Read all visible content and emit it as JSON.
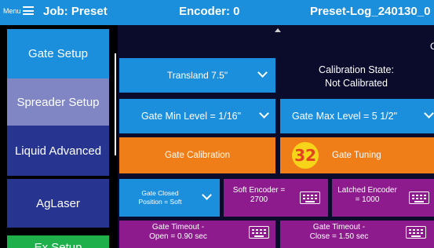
{
  "header": {
    "menu_label": "Menu",
    "job": "Job: Preset",
    "encoder": "Encoder: 0",
    "log": "Preset-Log_240130_0"
  },
  "sidebar": {
    "items": [
      {
        "label": "Gate Setup"
      },
      {
        "label": "Spreader Setup"
      },
      {
        "label": "Liquid Advanced"
      },
      {
        "label": "AgLaser"
      },
      {
        "label": "Ex Setup"
      }
    ]
  },
  "main": {
    "edge_char": "C",
    "transland": "Transland 7.5\"",
    "calibration_state_label": "Calibration State:",
    "calibration_state_value": "Not Calibrated",
    "gate_min": "Gate Min Level = 1/16\"",
    "gate_max": "Gate Max Level = 5 1/2\"",
    "gate_calibration": "Gate Calibration",
    "gate_tuning": "Gate Tuning",
    "badge": "32",
    "gate_closed_line1": "Gate Closed",
    "gate_closed_line2": "Position = Soft",
    "soft_encoder_line1": "Soft Encoder =",
    "soft_encoder_line2": "2700",
    "latched_encoder_line1": "Latched Encoder",
    "latched_encoder_line2": "= 1000",
    "gate_timeout_open_line1": "Gate Timeout -",
    "gate_timeout_open_line2": "Open = 0.90 sec",
    "gate_timeout_close_line1": "Gate Timeout -",
    "gate_timeout_close_line2": "Close = 1.50 sec"
  },
  "colors": {
    "header": "#1c8fdc",
    "blue_button": "#1c8fdc",
    "selected_item": "#7f86c3",
    "nav_item": "#283590",
    "orange_button": "#ef7d18",
    "purple_button": "#8e1b8e",
    "green_button": "#20b04b",
    "badge": "#f5d41a"
  },
  "icons": [
    "hamburger-icon",
    "chevron-down-icon",
    "keyboard-icon",
    "scroll-up-arrow-icon"
  ]
}
